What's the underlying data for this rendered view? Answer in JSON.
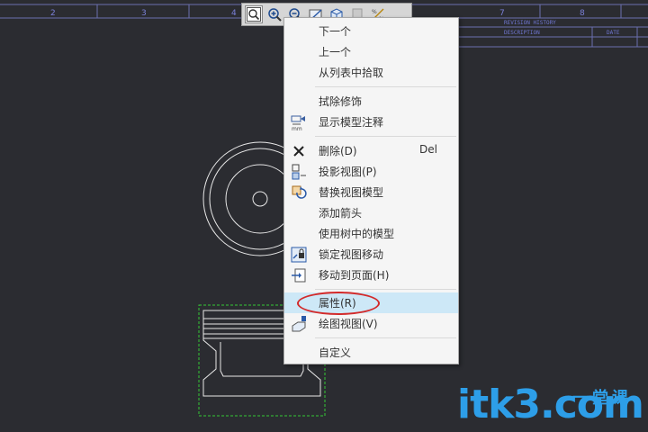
{
  "border_ruler": {
    "labels": [
      "2",
      "3",
      "4",
      "7",
      "8"
    ]
  },
  "title_block": {
    "revision_history": "REVISION HISTORY",
    "description": "DESCRIPTION",
    "date": "DATE"
  },
  "toolbar": {
    "buttons": [
      {
        "icon": "zoom-window-icon"
      },
      {
        "icon": "zoom-in-icon"
      },
      {
        "icon": "zoom-out-icon"
      },
      {
        "icon": "edge-display-icon"
      },
      {
        "icon": "box-display-icon"
      },
      {
        "icon": "spin-center-icon"
      },
      {
        "icon": "annotation-display-icon"
      }
    ]
  },
  "context_menu": {
    "items": [
      {
        "label": "下一个"
      },
      {
        "label": "上一个"
      },
      {
        "label": "从列表中拾取"
      },
      {
        "label": "拭除修饰"
      },
      {
        "label": "显示模型注释",
        "icon": "show-annotation-icon"
      },
      {
        "label": "删除(D)",
        "shortcut": "Del",
        "icon": "delete-icon"
      },
      {
        "label": "投影视图(P)",
        "icon": "projection-view-icon"
      },
      {
        "label": "替换视图模型",
        "icon": "replace-model-icon"
      },
      {
        "label": "添加箭头"
      },
      {
        "label": "使用树中的模型"
      },
      {
        "label": "锁定视图移动",
        "icon": "lock-view-icon"
      },
      {
        "label": "移动到页面(H)",
        "icon": "move-to-sheet-icon"
      },
      {
        "label": "属性(R)",
        "highlighted": true
      },
      {
        "label": "绘图视图(V)",
        "icon": "drawing-view-icon"
      },
      {
        "label": "自定义"
      }
    ]
  },
  "watermark": {
    "text": "itk3.com",
    "cn_text": "一堂课"
  },
  "colors": {
    "background": "#2b2c31",
    "menu_bg": "#f5f5f5",
    "highlight": "#cde8f7",
    "annotation_red": "#d32a2a",
    "watermark_blue": "#2d9ee8"
  }
}
